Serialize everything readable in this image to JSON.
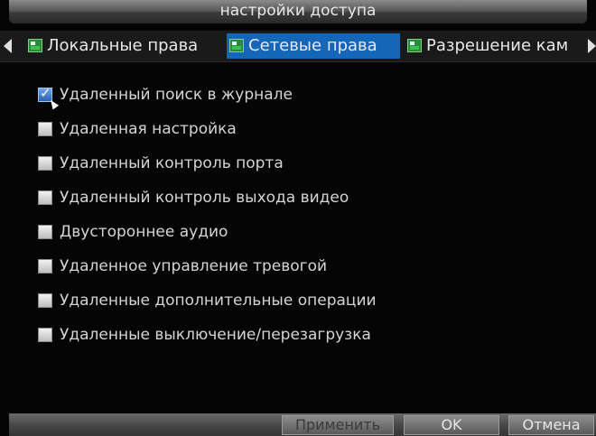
{
  "title": "настройки доступа",
  "tabs": [
    {
      "label": "Локальные права",
      "active": false
    },
    {
      "label": "Сетевые права",
      "active": true
    },
    {
      "label": "Разрешение кам",
      "active": false
    }
  ],
  "permissions": [
    {
      "label": "Удаленный поиск в журнале",
      "checked": true
    },
    {
      "label": "Удаленная настройка",
      "checked": false
    },
    {
      "label": "Удаленный контроль порта",
      "checked": false
    },
    {
      "label": "Удаленный контроль выхода видео",
      "checked": false
    },
    {
      "label": "Двустороннее аудио",
      "checked": false
    },
    {
      "label": "Удаленное управление тревогой",
      "checked": false
    },
    {
      "label": "Удаленные дополнительные операции",
      "checked": false
    },
    {
      "label": "Удаленные выключение/перезагрузка",
      "checked": false
    }
  ],
  "buttons": {
    "apply": {
      "label": "Применить",
      "enabled": false
    },
    "ok": {
      "label": "OK",
      "enabled": true
    },
    "cancel": {
      "label": "Отмена",
      "enabled": true
    }
  },
  "colors": {
    "active_tab": "#1565b8",
    "background": "#050505"
  }
}
